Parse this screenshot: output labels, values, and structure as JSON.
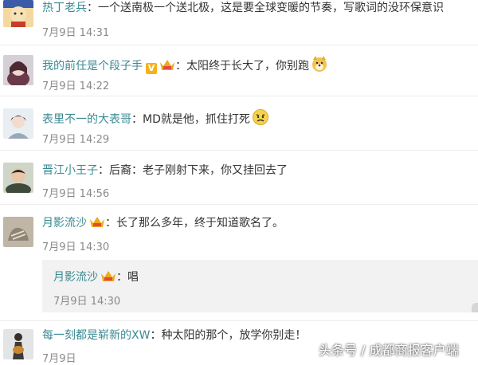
{
  "comments": [
    {
      "user": "热丁老兵",
      "sep": "：",
      "text": "一个送南极一个送北极，这是要全球变暖的节奏，写歌词的没环保意识",
      "time": "7月9日  14:31"
    },
    {
      "user": "我的前任是个段子手",
      "sep": "：",
      "text": "太阳终于长大了，你别跑",
      "time": "7月9日  14:22"
    },
    {
      "user": "表里不一的大表哥",
      "sep": "：",
      "text": "MD就是他，抓住打死",
      "time": "7月9日  14:29"
    },
    {
      "user": "晋江小王子",
      "sep": "：",
      "text": "后裔：老子刚射下来，你又挂回去了",
      "time": "7月9日  14:56"
    },
    {
      "user": "月影流沙",
      "sep": "：",
      "text": "长了那么多年，终于知道歌名了。",
      "time": "7月9日  14:30"
    },
    {
      "user": "每一刻都是崭新的XW",
      "sep": "：",
      "text": "种太阳的那个，放学你别走！",
      "time": "7月9日"
    }
  ],
  "reply": {
    "user": "月影流沙",
    "sep": "：",
    "text": "唱",
    "time": "7月9日  14:30"
  },
  "watermark": "头条号 / 成都商报客户端",
  "colors": {
    "username": "#3a8a93",
    "time": "#8a8a8a",
    "reply_bg": "#f2f2f2"
  }
}
